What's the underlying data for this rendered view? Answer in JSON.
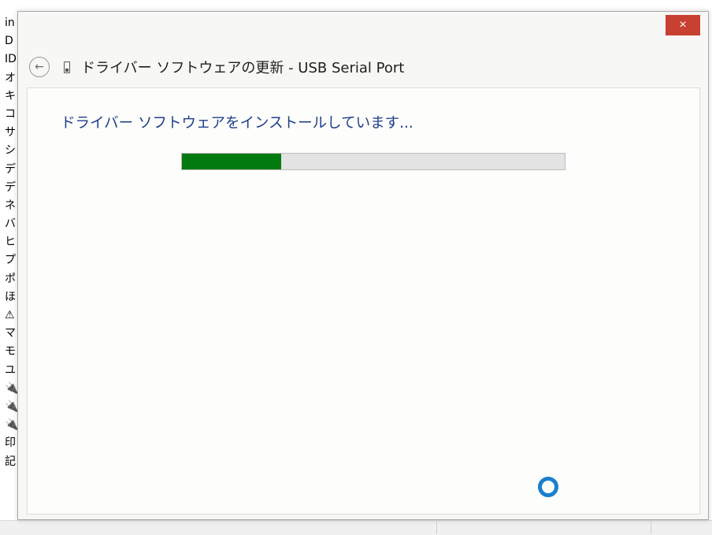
{
  "background": {
    "device_list": [
      {
        "glyph": "in"
      },
      {
        "glyph": "D"
      },
      {
        "glyph": "ID"
      },
      {
        "glyph": "オ"
      },
      {
        "glyph": "キ"
      },
      {
        "glyph": "コ"
      },
      {
        "glyph": "サ"
      },
      {
        "glyph": "シ"
      },
      {
        "glyph": "デ"
      },
      {
        "glyph": "デ"
      },
      {
        "glyph": "ネ"
      },
      {
        "glyph": "バ"
      },
      {
        "glyph": "ヒ"
      },
      {
        "glyph": "プ"
      },
      {
        "glyph": "ポ"
      },
      {
        "glyph": "ほ"
      },
      {
        "glyph": "⚠"
      },
      {
        "glyph": "マ"
      },
      {
        "glyph": "モ"
      },
      {
        "glyph": "ユ"
      },
      {
        "glyph": "🔌"
      },
      {
        "glyph": "🔌"
      },
      {
        "glyph": "🔌"
      },
      {
        "glyph": "印"
      },
      {
        "glyph": "記"
      }
    ]
  },
  "dialog": {
    "title": "ドライバー ソフトウェアの更新 - USB Serial Port",
    "close_label": "×",
    "back_icon": "←",
    "install_message": "ドライバー ソフトウェアをインストールしています...",
    "progress_fraction": 0.26
  },
  "colors": {
    "close": "#c84031",
    "progress_fill": "#037a0f",
    "spinner": "#1a7fd0",
    "message": "#1f3f8a"
  }
}
